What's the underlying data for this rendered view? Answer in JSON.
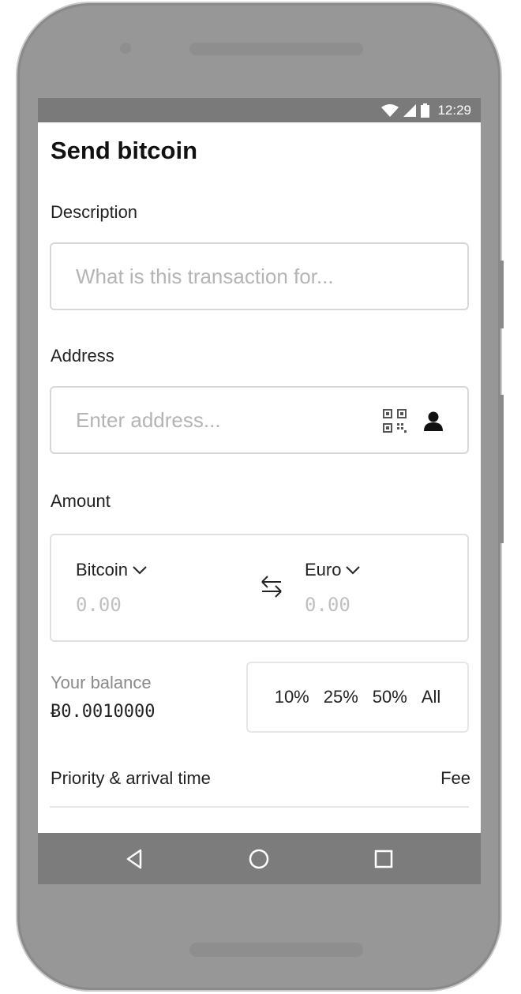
{
  "status_bar": {
    "time": "12:29",
    "icons": [
      "wifi-icon",
      "signal-icon",
      "battery-icon"
    ]
  },
  "page": {
    "title": "Send bitcoin"
  },
  "description": {
    "label": "Description",
    "placeholder": "What is this transaction for..."
  },
  "address": {
    "label": "Address",
    "placeholder": "Enter address...",
    "icons": [
      "qr-code-icon",
      "contact-icon"
    ]
  },
  "amount": {
    "label": "Amount",
    "from_currency": "Bitcoin",
    "from_value": "0.00",
    "to_currency": "Euro",
    "to_value": "0.00"
  },
  "balance": {
    "label": "Your balance",
    "value": "Ƀ0.0010000"
  },
  "percent_options": [
    "10%",
    "25%",
    "50%",
    "All"
  ],
  "priority": {
    "label": "Priority & arrival time",
    "fee_label": "Fee"
  },
  "nav_bar": {
    "icons": [
      "back-icon",
      "home-icon",
      "recents-icon"
    ]
  },
  "colors": {
    "status_bar": "#7a7a7a",
    "nav_bar": "#7c7c7c",
    "phone_frame": "#979797",
    "placeholder": "#b4b4b4"
  }
}
